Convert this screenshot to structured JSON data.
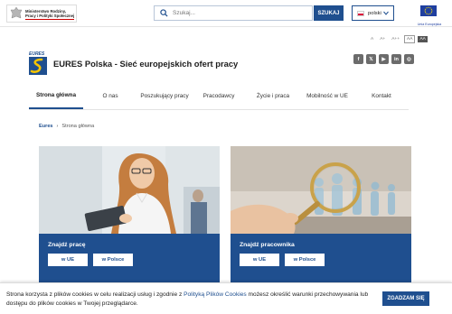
{
  "ministry": {
    "lines": [
      "Ministerstwo Rodziny,",
      "Pracy i Polityki Społecznej"
    ]
  },
  "search": {
    "placeholder": "Szukaj...",
    "button_label": "SZUKAJ"
  },
  "language": {
    "selected": "polski"
  },
  "eu": {
    "label": "Unia Europejska"
  },
  "font_controls": [
    "A",
    "A+",
    "A++",
    "AA",
    "AA"
  ],
  "header": {
    "logo_text": "EURES",
    "title": "EURES Polska - Sieć europejskich ofert pracy"
  },
  "social": [
    "f",
    "𝕏",
    "▶",
    "in",
    "◎"
  ],
  "nav": {
    "items": [
      {
        "label": "Strona główna"
      },
      {
        "label": "O nas"
      },
      {
        "label": "Poszukujący pracy"
      },
      {
        "label": "Pracodawcy"
      },
      {
        "label": "Życie i praca"
      },
      {
        "label": "Mobilność w UE"
      },
      {
        "label": "Kontakt"
      }
    ]
  },
  "breadcrumb": {
    "home": "Eures",
    "separator": "›",
    "current": "Strona główna"
  },
  "cards": [
    {
      "title": "Znajdź pracę",
      "btn1": "w UE",
      "btn2": "w Polsce"
    },
    {
      "title": "Znajdź pracownika",
      "btn1": "w UE",
      "btn2": "w Polsce"
    }
  ],
  "cookie": {
    "text_before": "Strona korzysta z plików cookies w celu realizacji usług i zgodnie z ",
    "link": "Polityką Plików Cookies",
    "text_after": " możesz określić warunki przechowywania lub dostępu do plików cookies w Twojej przeglądarce.",
    "button": "ZGADZAM SIĘ"
  },
  "colors": {
    "primary": "#1f4f8f",
    "eu_blue": "#1f3fa0",
    "eu_star": "#ffdd00",
    "polish_red": "#dc143c"
  }
}
